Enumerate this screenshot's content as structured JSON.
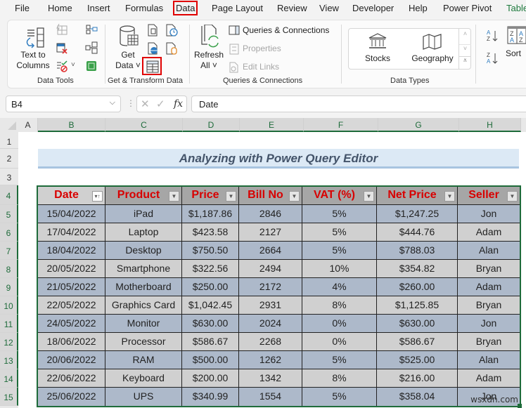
{
  "menu": {
    "tabs": [
      {
        "label": "File"
      },
      {
        "label": "Home"
      },
      {
        "label": "Insert"
      },
      {
        "label": "Formulas"
      },
      {
        "label": "Data",
        "active": true
      },
      {
        "label": "Page Layout"
      },
      {
        "label": "Review"
      },
      {
        "label": "View"
      },
      {
        "label": "Developer"
      },
      {
        "label": "Help"
      },
      {
        "label": "Power Pivot"
      },
      {
        "label": "Table"
      }
    ]
  },
  "ribbon": {
    "data_tools": {
      "label": "Data Tools",
      "text_to_columns_line1": "Text to",
      "text_to_columns_line2": "Columns"
    },
    "get_transform": {
      "label": "Get & Transform Data",
      "get_data_line1": "Get",
      "get_data_line2": "Data ˅"
    },
    "queries": {
      "label": "Queries & Connections",
      "refresh_line1": "Refresh",
      "refresh_line2": "All ˅",
      "queries_connections": "Queries & Connections",
      "properties": "Properties",
      "edit_links": "Edit Links"
    },
    "data_types": {
      "label": "Data Types",
      "stocks": "Stocks",
      "geography": "Geography"
    },
    "sort": {
      "sort_label": "Sort"
    }
  },
  "formula_bar": {
    "name_box": "B4",
    "fx": "fx",
    "content": "Date"
  },
  "grid": {
    "columns": [
      "A",
      "B",
      "C",
      "D",
      "E",
      "F",
      "G",
      "H"
    ],
    "rows": [
      "1",
      "2",
      "3",
      "4",
      "5",
      "6",
      "7",
      "8",
      "9",
      "10",
      "11",
      "12",
      "13",
      "14",
      "15"
    ]
  },
  "sheet": {
    "title": "Analyzing with Power Query Editor",
    "table": {
      "headers": [
        "Date",
        "Product",
        "Price",
        "Bill No",
        "VAT (%)",
        "Net Price",
        "Seller"
      ],
      "rows": [
        [
          "15/04/2022",
          "iPad",
          "$1,187.86",
          "2846",
          "5%",
          "$1,247.25",
          "Jon"
        ],
        [
          "17/04/2022",
          "Laptop",
          "$423.58",
          "2127",
          "5%",
          "$444.76",
          "Adam"
        ],
        [
          "18/04/2022",
          "Desktop",
          "$750.50",
          "2664",
          "5%",
          "$788.03",
          "Alan"
        ],
        [
          "20/05/2022",
          "Smartphone",
          "$322.56",
          "2494",
          "10%",
          "$354.82",
          "Bryan"
        ],
        [
          "21/05/2022",
          "Motherboard",
          "$250.00",
          "2172",
          "4%",
          "$260.00",
          "Adam"
        ],
        [
          "22/05/2022",
          "Graphics Card",
          "$1,042.45",
          "2931",
          "8%",
          "$1,125.85",
          "Bryan"
        ],
        [
          "24/05/2022",
          "Monitor",
          "$630.00",
          "2024",
          "0%",
          "$630.00",
          "Jon"
        ],
        [
          "18/06/2022",
          "Processor",
          "$586.67",
          "2268",
          "0%",
          "$586.67",
          "Bryan"
        ],
        [
          "20/06/2022",
          "RAM",
          "$500.00",
          "1262",
          "5%",
          "$525.00",
          "Alan"
        ],
        [
          "22/06/2022",
          "Keyboard",
          "$200.00",
          "1342",
          "8%",
          "$216.00",
          "Adam"
        ],
        [
          "25/06/2022",
          "UPS",
          "$340.99",
          "1554",
          "5%",
          "$358.04",
          "Jon"
        ]
      ]
    },
    "watermark": "wsxdn.com"
  },
  "colors": {
    "highlight_red": "#e00000",
    "header_text": "#d80000",
    "band_blue": "#adb9ca",
    "band_gray": "#d0d0d0",
    "title_bg": "#dce9f5",
    "excel_green": "#1e6b3a"
  }
}
